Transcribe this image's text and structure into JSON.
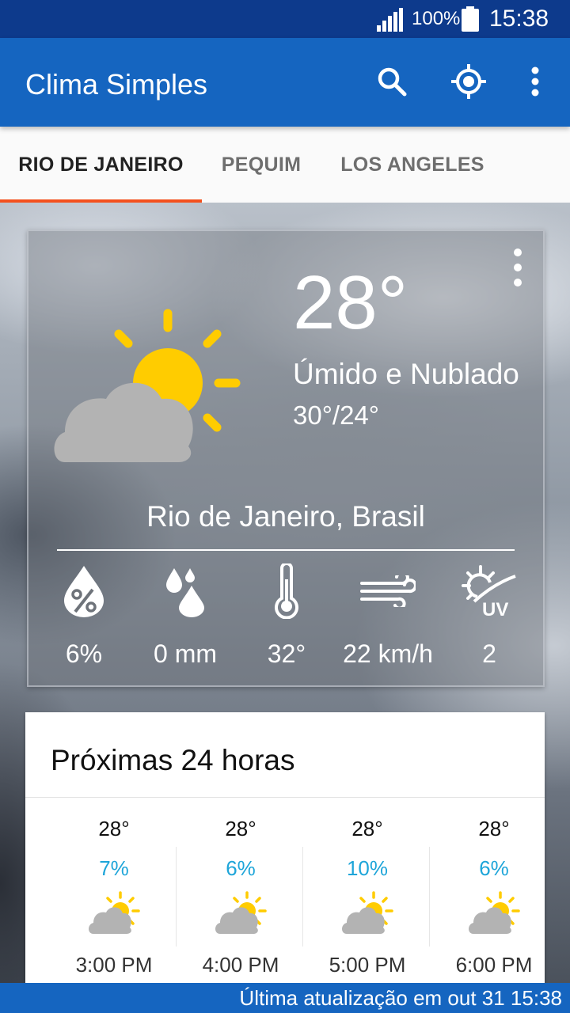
{
  "status_bar": {
    "battery_percent": "100%",
    "time": "15:38",
    "icons": [
      "signal-icon",
      "battery-icon"
    ]
  },
  "app_bar": {
    "title": "Clima Simples",
    "actions": [
      "search-icon",
      "my-location-icon",
      "more-vert-icon"
    ]
  },
  "tabs": [
    {
      "label": "RIO DE JANEIRO",
      "active": true
    },
    {
      "label": "PEQUIM",
      "active": false
    },
    {
      "label": "LOS ANGELES",
      "active": false
    }
  ],
  "current": {
    "temperature": "28°",
    "condition": "Úmido e Nublado",
    "range": "30°/24°",
    "location": "Rio de Janeiro, Brasil",
    "icon": "partly-cloudy-icon",
    "metrics": [
      {
        "name": "humidity",
        "icon": "humidity-icon",
        "value": "6%"
      },
      {
        "name": "precipitation",
        "icon": "rain-drops-icon",
        "value": "0 mm"
      },
      {
        "name": "feels-like",
        "icon": "thermometer-icon",
        "value": "32°"
      },
      {
        "name": "wind",
        "icon": "wind-icon",
        "value": "22 km/h"
      },
      {
        "name": "uv-index",
        "icon": "uv-icon",
        "value": "2"
      }
    ]
  },
  "forecast": {
    "title": "Próximas 24 horas",
    "items": [
      {
        "temp": "28°",
        "rain": "7%",
        "time": "3:00 PM",
        "icon": "partly-cloudy-icon"
      },
      {
        "temp": "28°",
        "rain": "6%",
        "time": "4:00 PM",
        "icon": "partly-cloudy-icon"
      },
      {
        "temp": "28°",
        "rain": "10%",
        "time": "5:00 PM",
        "icon": "partly-cloudy-icon"
      },
      {
        "temp": "28°",
        "rain": "6%",
        "time": "6:00 PM",
        "icon": "partly-cloudy-icon"
      }
    ]
  },
  "footer": {
    "last_update": "Última atualização em out 31 15:38"
  },
  "colors": {
    "status_bar": "#0d3a8c",
    "primary": "#1565c0",
    "tab_indicator": "#f4511e",
    "sun": "#ffcc00",
    "cloud": "#b3b3b3",
    "rain_percent": "#1ea5d9"
  }
}
